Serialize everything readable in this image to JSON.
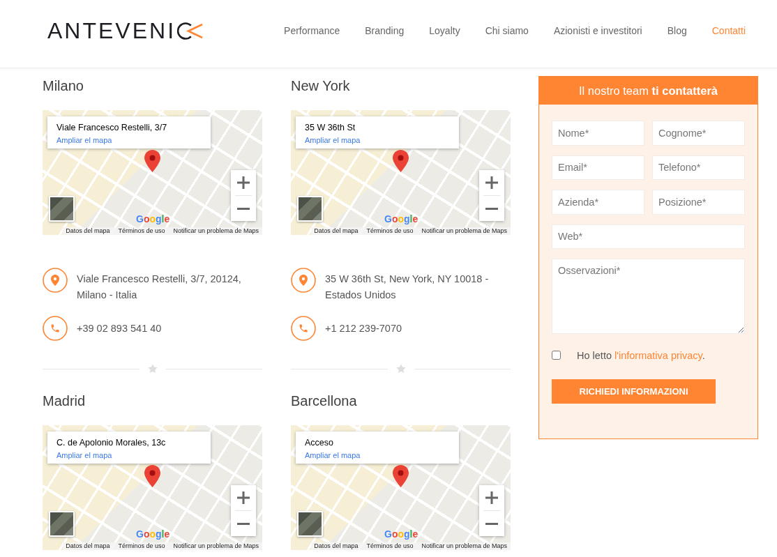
{
  "header": {
    "logo": "ANTEVENI",
    "nav": [
      {
        "label": "Performance",
        "selected": false
      },
      {
        "label": "Branding",
        "selected": false
      },
      {
        "label": "Loyalty",
        "selected": false
      },
      {
        "label": "Chi siamo",
        "selected": false
      },
      {
        "label": "Azionisti e investitori",
        "selected": false
      },
      {
        "label": "Blog",
        "selected": false
      },
      {
        "label": "Contatti",
        "selected": true
      }
    ]
  },
  "offices": [
    {
      "city": "Milano",
      "map": {
        "place": "Viale Francesco Restelli, 3/7",
        "link": "Ampliar el mapa",
        "logo": "Google",
        "footer_links": [
          "Datos del mapa",
          "Términos de uso",
          "Notificar un problema de Maps"
        ]
      },
      "address": "Viale Francesco Restelli, 3/7, 20124, Milano - Italia",
      "phone": "+39 02 893 541 40"
    },
    {
      "city": "New York",
      "map": {
        "place": "35 W 36th St",
        "link": "Ampliar el mapa",
        "logo": "Google",
        "footer_links": [
          "Datos del mapa",
          "Términos de uso",
          "Notificar un problema de Maps"
        ]
      },
      "address": "35 W 36th St, New York, NY 10018 - Estados Unidos",
      "phone": "+1 212 239-7070"
    },
    {
      "city": "Madrid",
      "map": {
        "place": "C. de Apolonio Morales, 13c",
        "link": "Ampliar el mapa",
        "logo": "Google",
        "footer_links": [
          "Datos del mapa",
          "Términos de uso",
          "Notificar un problema de Maps"
        ]
      }
    },
    {
      "city": "Barcellona",
      "map": {
        "place": "Acceso",
        "link": "Ampliar el mapa",
        "logo": "Google",
        "footer_links": [
          "Datos del mapa",
          "Términos de uso",
          "Notificar un problema de Maps"
        ]
      }
    }
  ],
  "contact_form": {
    "title": "Il nostro team **ti contatterà**",
    "rows": [
      [
        {
          "kind": "input",
          "placeholder": "Nome*"
        },
        {
          "kind": "input",
          "placeholder": "Cognome*"
        }
      ],
      [
        {
          "kind": "input",
          "placeholder": "Email*"
        },
        {
          "kind": "input",
          "placeholder": "Telefono*"
        }
      ],
      [
        {
          "kind": "input",
          "placeholder": "Azienda*"
        },
        {
          "kind": "input",
          "placeholder": "Posizione*"
        }
      ],
      [
        {
          "kind": "input",
          "placeholder": "Web*"
        }
      ],
      [
        {
          "kind": "textarea",
          "placeholder": "Osservazioni*"
        }
      ]
    ],
    "consent": {
      "checked": false,
      "text": "Ho letto",
      "link": "l'informativa privacy",
      "end": "."
    },
    "submit": "RICHIEDI INFORMAZIONI"
  }
}
